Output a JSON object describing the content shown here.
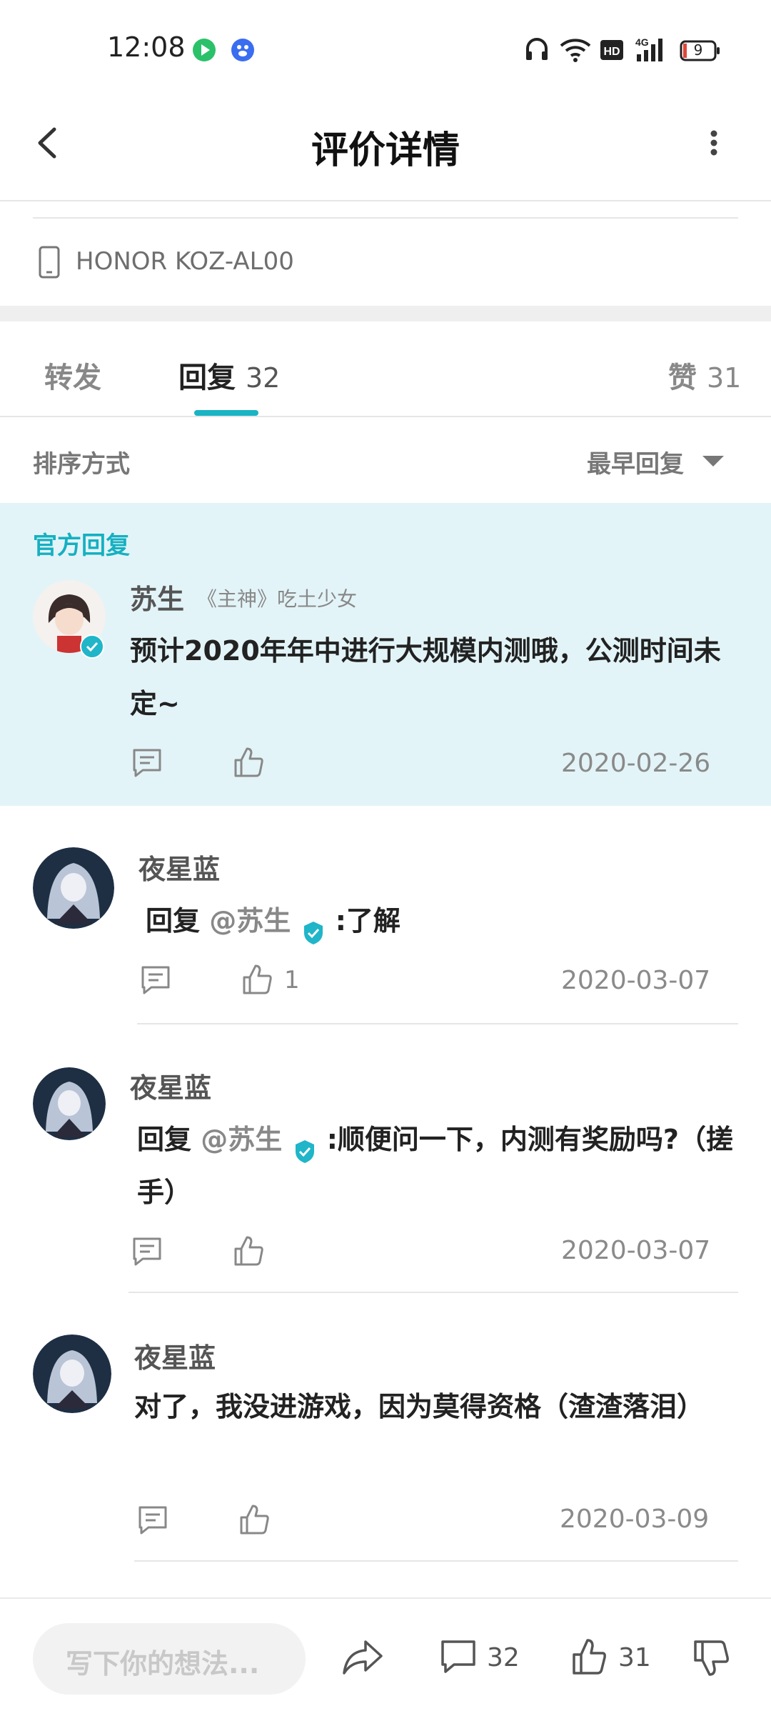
{
  "status_bar": {
    "time": "12:08",
    "network": "4G",
    "battery": "9"
  },
  "header": {
    "title": "评价详情"
  },
  "device": {
    "model": "HONOR KOZ-AL00"
  },
  "tabs": [
    {
      "label": "转发",
      "count": ""
    },
    {
      "label": "回复",
      "count": "32"
    },
    {
      "label": "赞",
      "count": "31"
    }
  ],
  "sort": {
    "label": "排序方式",
    "value": "最早回复"
  },
  "official_reply": {
    "section_label": "官方回复",
    "author": "苏生",
    "author_tag": "《主神》吃土少女",
    "content": "预计2020年年中进行大规模内测哦，公测时间未定~",
    "date": "2020-02-26"
  },
  "replies": [
    {
      "author": "夜星蓝",
      "prefix": "回复",
      "mention": "@苏生",
      "content": ":了解",
      "likes": "1",
      "date": "2020-03-07"
    },
    {
      "author": "夜星蓝",
      "prefix": "回复",
      "mention": "@苏生",
      "content": ":顺便问一下，内测有奖励吗?（搓手）",
      "likes": "",
      "date": "2020-03-07"
    },
    {
      "author": "夜星蓝",
      "prefix": "",
      "mention": "",
      "content": "对了，我没进游戏，因为莫得资格（渣渣落泪）",
      "likes": "",
      "date": "2020-03-09"
    }
  ],
  "bottom_bar": {
    "placeholder": "写下你的想法...",
    "comment_count": "32",
    "like_count": "31"
  },
  "colors": {
    "accent": "#19b3c4",
    "official_bg": "#e3f4f8"
  }
}
